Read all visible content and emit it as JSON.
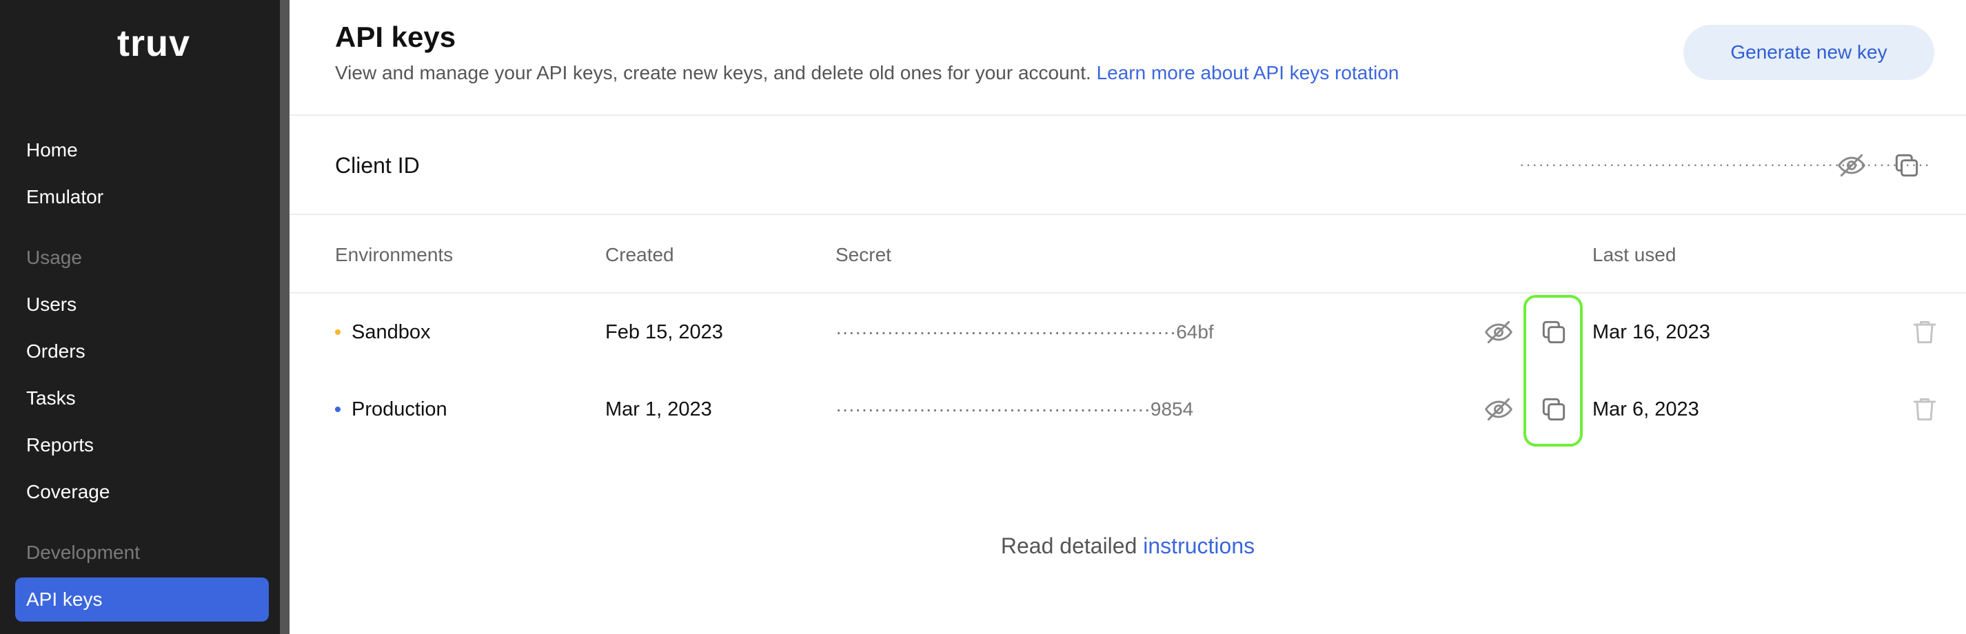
{
  "sidebar": {
    "logo": "truv",
    "items": [
      {
        "label": "Home"
      },
      {
        "label": "Emulator"
      },
      {
        "label": "Usage"
      },
      {
        "label": "Users"
      },
      {
        "label": "Orders"
      },
      {
        "label": "Tasks"
      },
      {
        "label": "Reports"
      },
      {
        "label": "Coverage"
      },
      {
        "label": "Development"
      },
      {
        "label": "API keys"
      }
    ]
  },
  "header": {
    "title": "API keys",
    "description": "View and manage your API keys, create new keys, and delete old ones for your account. ",
    "link_text": "Learn more about API keys rotation",
    "button_label": "Generate new key"
  },
  "client": {
    "label": "Client ID",
    "masked_value": "································································"
  },
  "table": {
    "headers": {
      "environments": "Environments",
      "created": "Created",
      "secret": "Secret",
      "last_used": "Last used"
    },
    "rows": [
      {
        "environment": "Sandbox",
        "env_color": "#f2b632",
        "created": "Feb 15, 2023",
        "secret_mask": "·····················································",
        "secret_suffix": "64bf",
        "last_used": "Mar 16, 2023"
      },
      {
        "environment": "Production",
        "env_color": "#3b66dd",
        "created": "Mar 1, 2023",
        "secret_mask": "·················································",
        "secret_suffix": "9854",
        "last_used": "Mar 6, 2023"
      }
    ]
  },
  "footer": {
    "text": "Read detailed ",
    "link_text": "instructions"
  },
  "colors": {
    "accent": "#3b66dd",
    "highlight": "#6fee39",
    "sidebar_bg": "#1e1e1e"
  }
}
